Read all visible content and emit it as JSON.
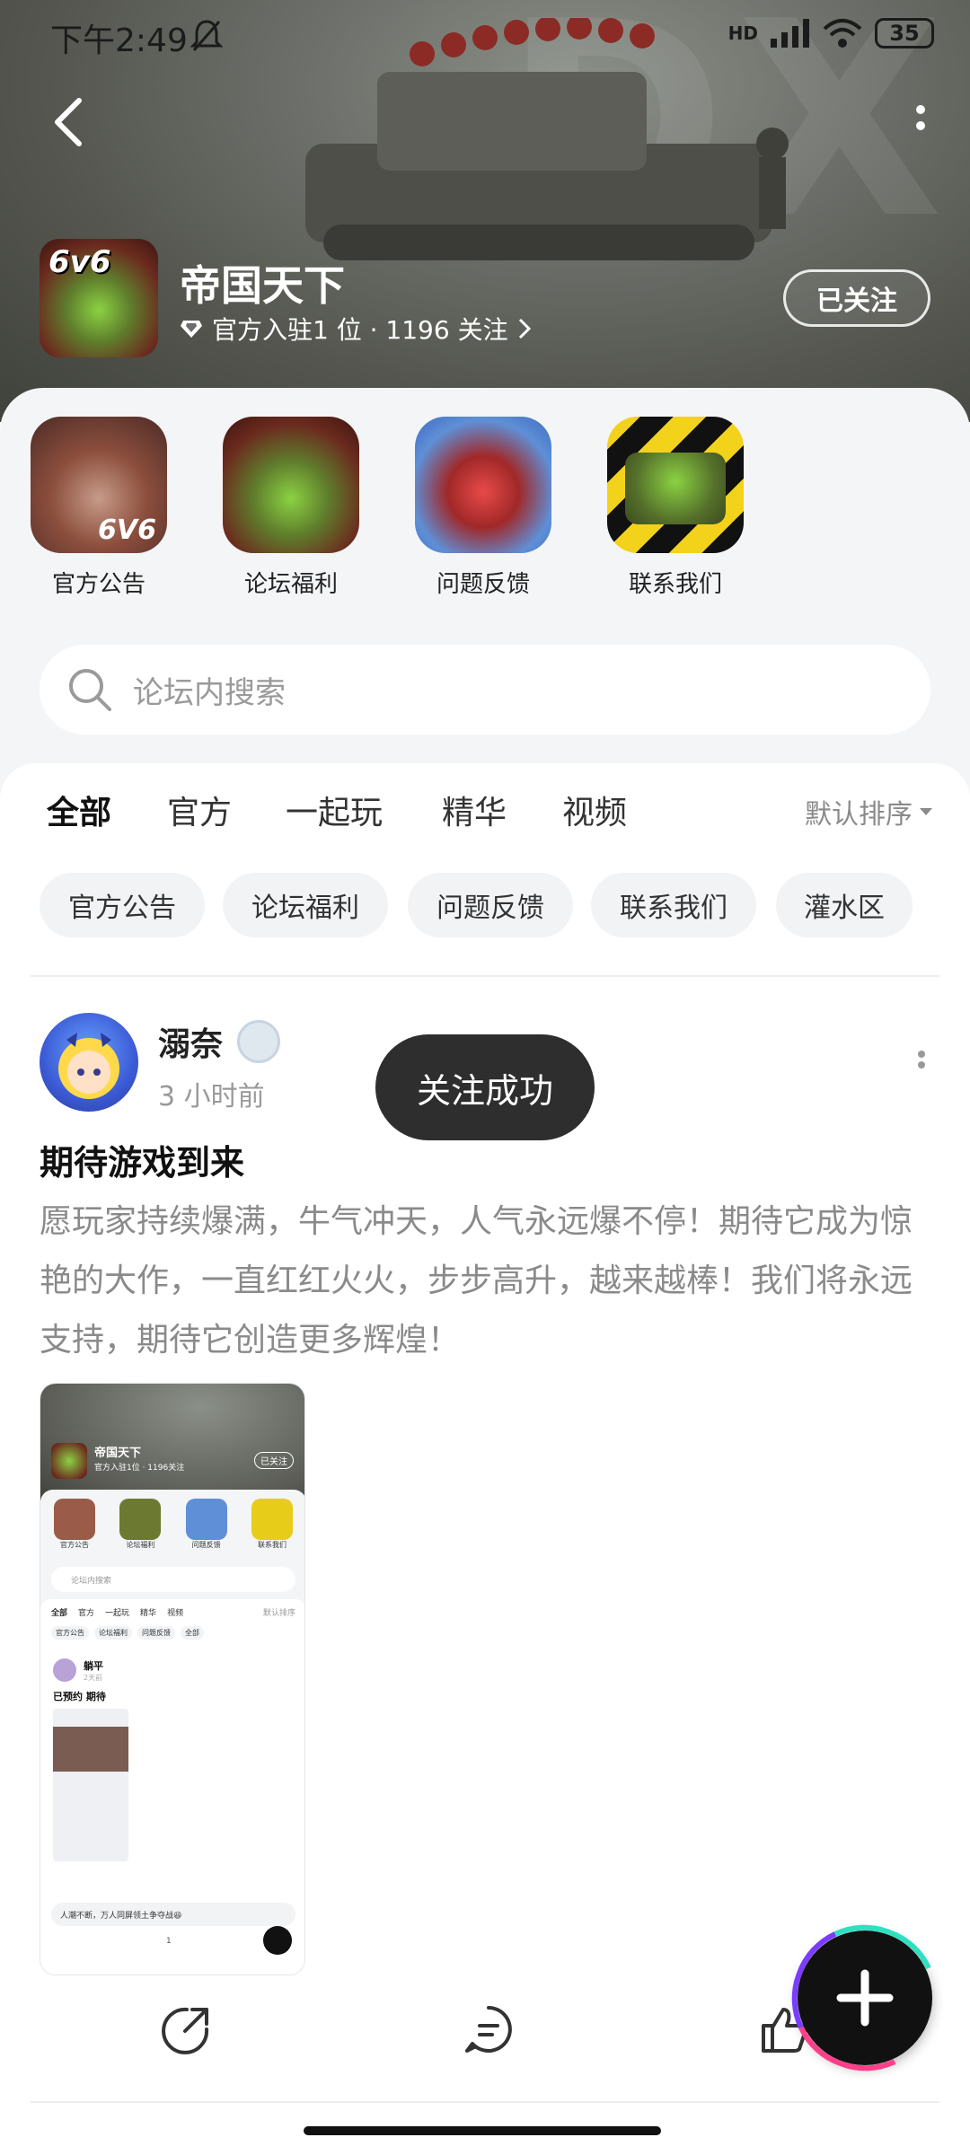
{
  "status_bar": {
    "time": "下午2:49",
    "battery": "35",
    "network": "HD"
  },
  "header": {
    "forum_title": "帝国天下",
    "forum_subtitle": "官方入驻1 位 · 1196 关注",
    "follow_button": "已关注",
    "icon_text": "6v6"
  },
  "quick_links": [
    {
      "label": "官方公告"
    },
    {
      "label": "论坛福利"
    },
    {
      "label": "问题反馈"
    },
    {
      "label": "联系我们"
    }
  ],
  "search": {
    "placeholder": "论坛内搜索"
  },
  "tabs": [
    {
      "label": "全部",
      "active": true
    },
    {
      "label": "官方"
    },
    {
      "label": "一起玩"
    },
    {
      "label": "精华"
    },
    {
      "label": "视频"
    }
  ],
  "sort": {
    "label": "默认排序"
  },
  "chips": [
    {
      "label": "官方公告"
    },
    {
      "label": "论坛福利"
    },
    {
      "label": "问题反馈"
    },
    {
      "label": "联系我们"
    },
    {
      "label": "灌水区"
    }
  ],
  "post": {
    "username": "溺奈",
    "time": "3 小时前",
    "title": "期待游戏到来",
    "body": "愿玩家持续爆满，牛气冲天，人气永远爆不停！期待它成为惊艳的大作，一直红红火火，步步高升，越来越棒！我们将永远支持，期待它创造更多辉煌！"
  },
  "toast": {
    "text": "关注成功"
  },
  "screenshot": {
    "title": "帝国天下",
    "follow": "已关注",
    "sub": "官方入驻1位 · 1196关注",
    "quick": [
      "官方公告",
      "论坛福利",
      "问题反馈",
      "联系我们"
    ],
    "search": "论坛内搜索",
    "tabs": [
      "全部",
      "官方",
      "一起玩",
      "精华",
      "视频",
      "默认排序"
    ],
    "chips": [
      "官方公告",
      "论坛福利",
      "问题反馈",
      "全部"
    ],
    "user": "躺平",
    "time": "2天前",
    "post_title": "已预约 期待",
    "comment_bar": "人潮不断，万人同屏领土争夺战😆",
    "comment_count": "1"
  },
  "colors": {
    "accent": "#2fd3a4",
    "toast_bg": "#2e2e2e"
  }
}
